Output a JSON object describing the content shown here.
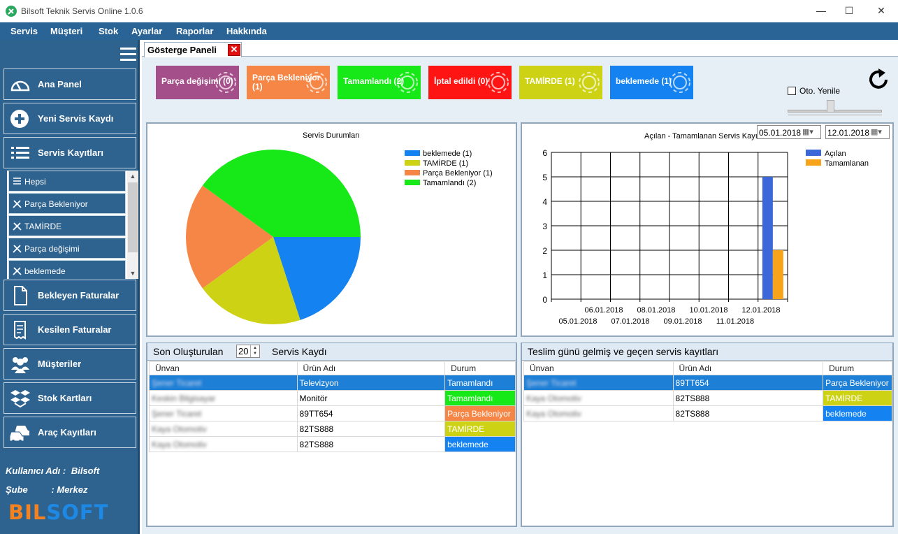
{
  "window": {
    "title": "Bilsoft Teknik Servis Online 1.0.6",
    "minimize": "—",
    "maximize": "☐",
    "close": "✕"
  },
  "menu": [
    "Servis",
    "Müşteri",
    "Stok",
    "Ayarlar",
    "Raporlar",
    "Hakkında"
  ],
  "sidebar": {
    "nav": [
      {
        "label": "Ana Panel",
        "icon": "dashboard-gauge-icon"
      },
      {
        "label": "Yeni Servis Kaydı",
        "icon": "plus-circle-icon"
      },
      {
        "label": "Servis Kayıtları",
        "icon": "list-icon"
      },
      {
        "label": "Bekleyen Faturalar",
        "icon": "document-icon"
      },
      {
        "label": "Kesilen Faturalar",
        "icon": "receipt-icon"
      },
      {
        "label": "Müşteriler",
        "icon": "users-icon"
      },
      {
        "label": "Stok Kartları",
        "icon": "boxes-icon"
      },
      {
        "label": "Araç Kayıtları",
        "icon": "cars-icon"
      }
    ],
    "sub_items": [
      "Hepsi",
      "Parça Bekleniyor",
      "TAMİRDE",
      "Parça değişimi",
      "beklemede"
    ],
    "user_label": "Kullanıcı Adı :",
    "user_value": "Bilsoft",
    "branch_label": "Şube",
    "branch_value": ": Merkez",
    "brand_left": "BIL",
    "brand_right": "SOFT"
  },
  "tab": {
    "label": "Gösterge Paneli",
    "close": "✕"
  },
  "status_tiles": [
    {
      "label": "Parça değişimi (0)",
      "color": "#a54f8a"
    },
    {
      "label": "Parça Bekleniyor (1)",
      "color": "#f58645"
    },
    {
      "label": "Tamamlandı (2)",
      "color": "#17e817"
    },
    {
      "label": "İptal edildi (0)",
      "color": "#ff1414"
    },
    {
      "label": "TAMİRDE (1)",
      "color": "#cdd314"
    },
    {
      "label": "beklemede (1)",
      "color": "#1482f0"
    }
  ],
  "auto_refresh": {
    "label": "Oto. Yenile",
    "checked": false
  },
  "pie": {
    "title": "Servis Durumları",
    "legend": [
      "beklemede (1)",
      "TAMİRDE (1)",
      "Parça Bekleniyor (1)",
      "Tamamlandı (2)"
    ]
  },
  "bar": {
    "title": "Açılan - Tamamlanan Servis Kayı",
    "date_from": "05.01.2018",
    "date_to": "12.01.2018",
    "legend": [
      "Açılan",
      "Tamamlanan"
    ],
    "y_ticks": [
      "0",
      "1",
      "2",
      "3",
      "4",
      "5",
      "6"
    ],
    "x_ticks_top": [
      "06.01.2018",
      "08.01.2018",
      "10.01.2018",
      "12.01.2018"
    ],
    "x_ticks_bottom": [
      "05.01.2018",
      "07.01.2018",
      "09.01.2018",
      "11.01.2018"
    ]
  },
  "chart_data": [
    {
      "type": "pie",
      "title": "Servis Durumları",
      "labels": [
        "beklemede",
        "TAMİRDE",
        "Parça Bekleniyor",
        "Tamamlandı"
      ],
      "values": [
        1,
        1,
        1,
        2
      ],
      "colors": [
        "#1482f0",
        "#cdd314",
        "#f58645",
        "#17e817"
      ],
      "legend_position": "top-right"
    },
    {
      "type": "bar",
      "title": "Açılan - Tamamlanan Servis Kayı",
      "categories": [
        "05.01.2018",
        "06.01.2018",
        "07.01.2018",
        "08.01.2018",
        "09.01.2018",
        "10.01.2018",
        "11.01.2018",
        "12.01.2018"
      ],
      "series": [
        {
          "name": "Açılan",
          "color": "#3c67d8",
          "values": [
            0,
            0,
            0,
            0,
            0,
            0,
            0,
            5
          ]
        },
        {
          "name": "Tamamlanan",
          "color": "#f8a41a",
          "values": [
            0,
            0,
            0,
            0,
            0,
            0,
            0,
            2
          ]
        }
      ],
      "ylim": [
        0,
        6
      ],
      "grid": true,
      "legend_position": "top-right"
    }
  ],
  "recent": {
    "title_left": "Son Oluşturulan",
    "count": "20",
    "title_right": "Servis Kaydı",
    "columns": [
      "Ünvan",
      "Ürün Adı",
      "Durum"
    ],
    "rows": [
      {
        "name": "Şener Ticaret",
        "product": "Televizyon",
        "status": "Tamamlandı",
        "color": "#1e7fd6",
        "selected": true
      },
      {
        "name": "Keskin Bilgisayar",
        "product": "Monitör",
        "status": "Tamamlandı",
        "color": "#17e817"
      },
      {
        "name": "Şener Ticaret",
        "product": "89TT654",
        "status": "Parça Bekleniyor",
        "color": "#f58645"
      },
      {
        "name": "Kaya Otomotiv",
        "product": "82TS888",
        "status": "TAMİRDE",
        "color": "#cdd314"
      },
      {
        "name": "Kaya Otomotiv",
        "product": "82TS888",
        "status": "beklemede",
        "color": "#1482f0"
      }
    ]
  },
  "overdue": {
    "title": "Teslim günü gelmiş ve geçen servis kayıtları",
    "columns": [
      "Ünvan",
      "Ürün Adı",
      "Durum"
    ],
    "rows": [
      {
        "name": "Şener Ticaret",
        "product": "89TT654",
        "status": "Parça Bekleniyor",
        "color": "#1e7fd6",
        "selected": true
      },
      {
        "name": "Kaya Otomotiv",
        "product": "82TS888",
        "status": "TAMİRDE",
        "color": "#cdd314"
      },
      {
        "name": "Kaya Otomotiv",
        "product": "82TS888",
        "status": "beklemede",
        "color": "#1482f0"
      }
    ]
  }
}
